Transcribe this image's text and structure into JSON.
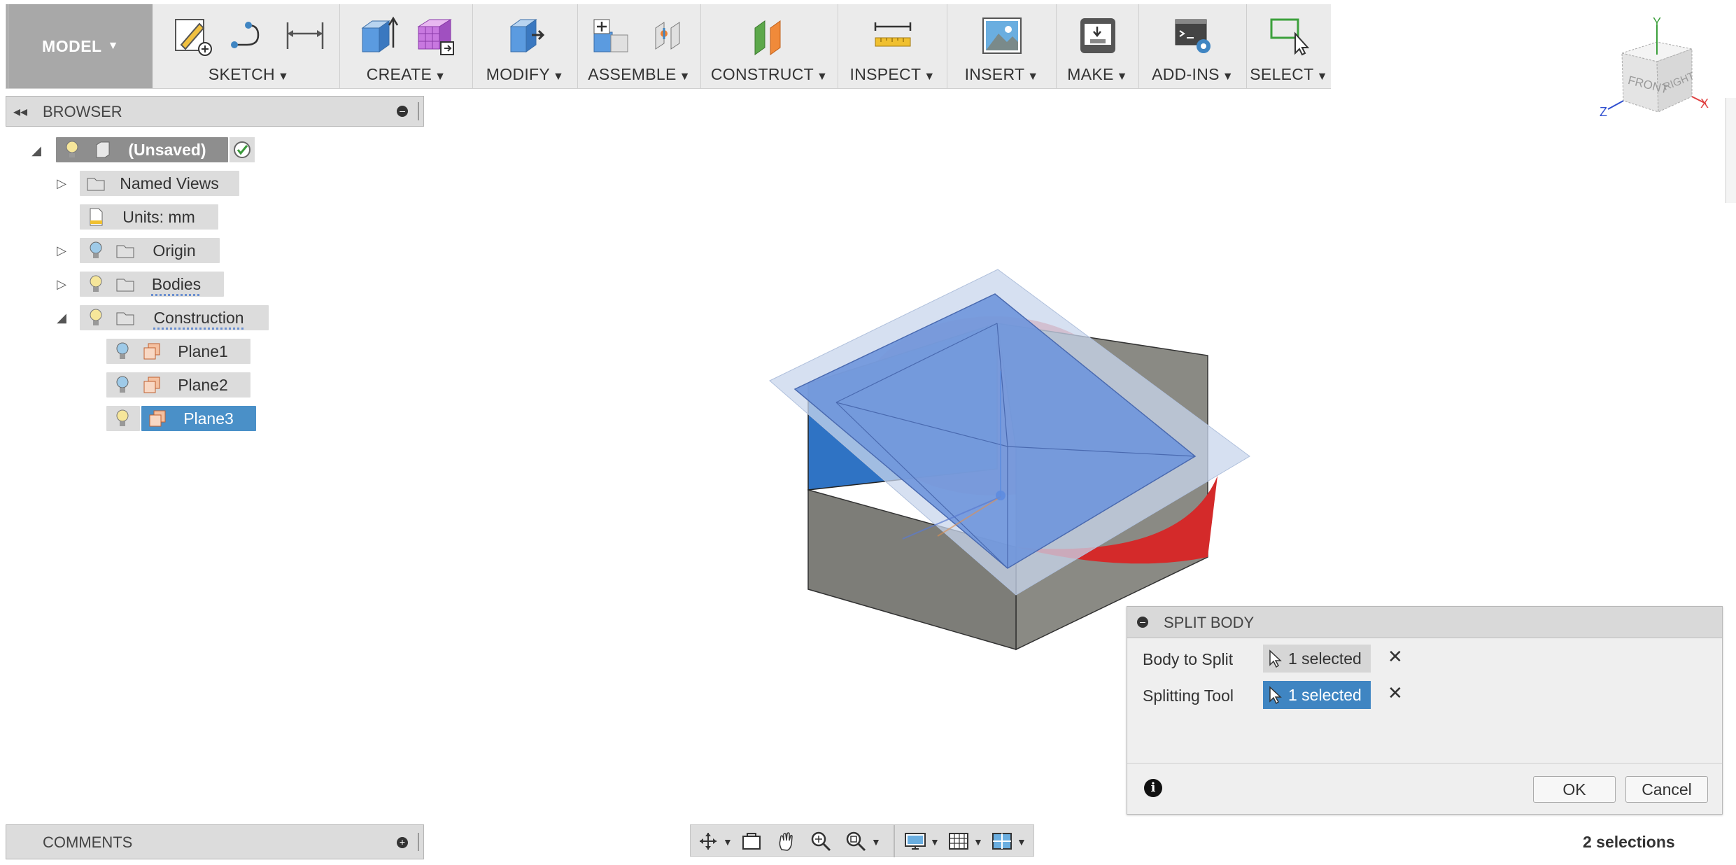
{
  "toolbar": {
    "workspace": "MODEL",
    "groups": [
      "SKETCH",
      "CREATE",
      "MODIFY",
      "ASSEMBLE",
      "CONSTRUCT",
      "INSPECT",
      "INSERT",
      "MAKE",
      "ADD-INS",
      "SELECT"
    ]
  },
  "browser": {
    "title": "BROWSER",
    "root": "(Unsaved)",
    "items": {
      "named_views": "Named Views",
      "units": "Units: mm",
      "origin": "Origin",
      "bodies": "Bodies",
      "construction": "Construction",
      "plane1": "Plane1",
      "plane2": "Plane2",
      "plane3": "Plane3"
    }
  },
  "comments": {
    "title": "COMMENTS"
  },
  "viewcube": {
    "front": "FRONT",
    "right": "RIGHT",
    "axis_x": "X",
    "axis_y": "Y",
    "axis_z": "Z"
  },
  "split_body": {
    "title": "SPLIT BODY",
    "body_to_split_label": "Body to Split",
    "body_to_split_value": "1 selected",
    "splitting_tool_label": "Splitting Tool",
    "splitting_tool_value": "1 selected",
    "ok": "OK",
    "cancel": "Cancel"
  },
  "status": {
    "selections": "2 selections"
  },
  "colors": {
    "selection_blue": "#3f85c2",
    "plane_blue": "#6f96dc",
    "sphere_red": "#e84a4a",
    "box_gray": "#8a8a84"
  }
}
